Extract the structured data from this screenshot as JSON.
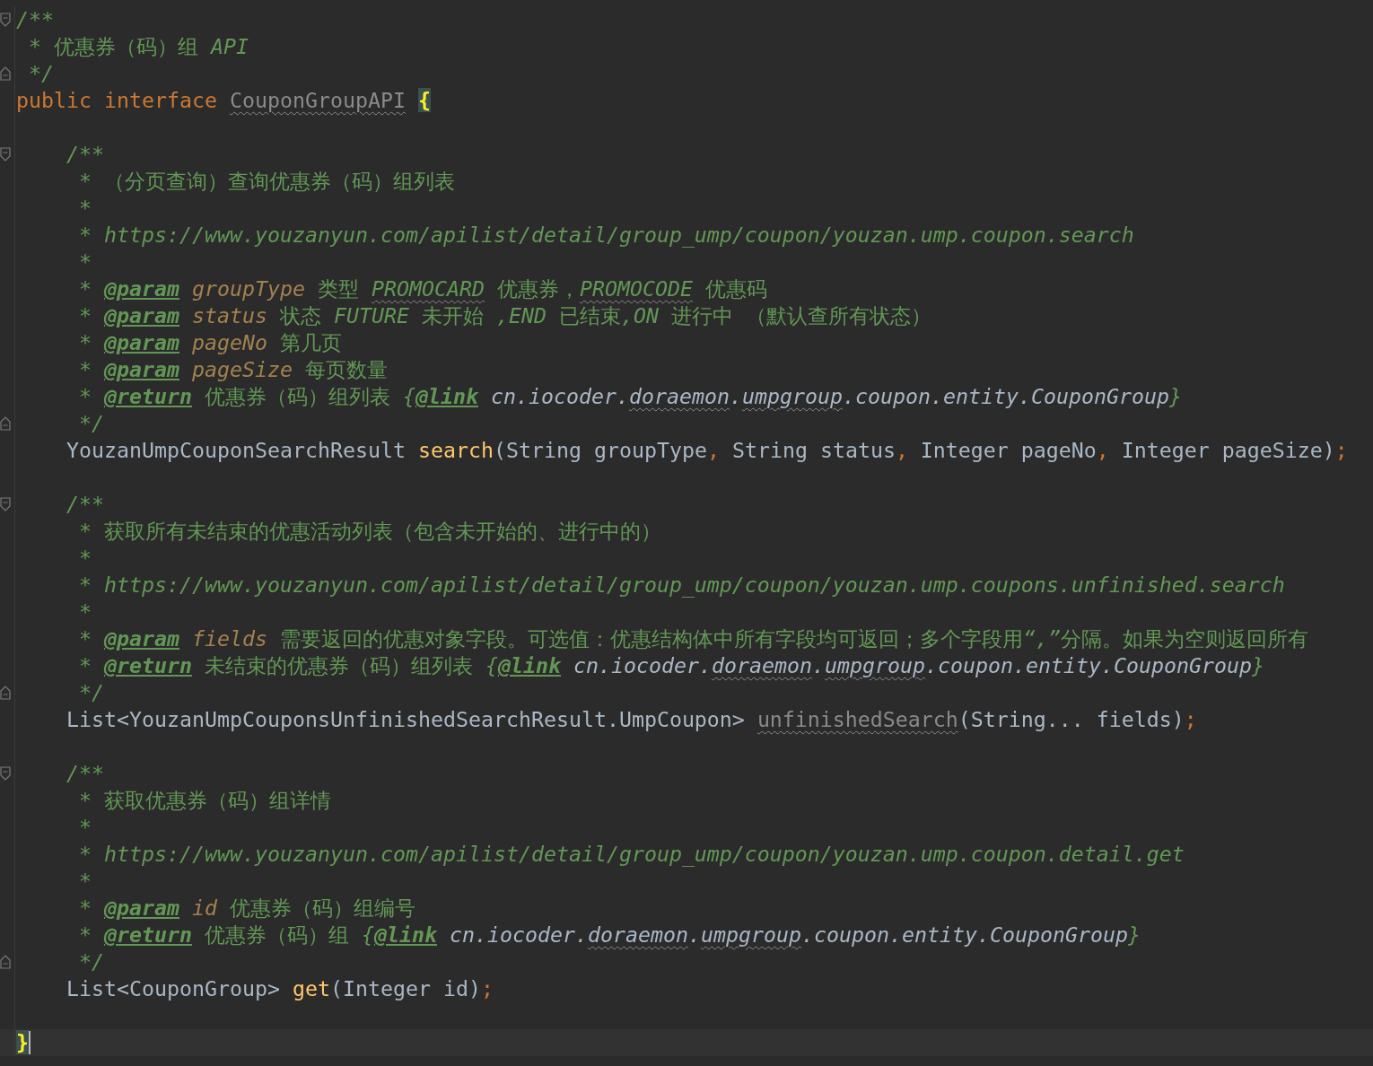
{
  "editor": {
    "lines": [
      {
        "kind": "fold-start",
        "current": false,
        "tokens": [
          {
            "text": "/**",
            "kind": "doc"
          }
        ]
      },
      {
        "kind": "code",
        "current": false,
        "tokens": [
          {
            "text": " * 优惠券（码）组 API",
            "kind": "doc"
          }
        ]
      },
      {
        "kind": "fold-end",
        "current": false,
        "tokens": [
          {
            "text": " */",
            "kind": "doc"
          }
        ]
      },
      {
        "kind": "code",
        "current": false,
        "tokens": [
          {
            "text": "public interface ",
            "kind": "keyword"
          },
          {
            "text": "CouponGroupAPI ",
            "kind": "unused"
          },
          {
            "text": "{",
            "kind": "brace"
          }
        ]
      },
      {
        "kind": "code",
        "current": false
      },
      {
        "kind": "fold-start",
        "current": false,
        "tokens": [
          {
            "text": "    /**",
            "kind": "doc"
          }
        ]
      },
      {
        "kind": "code",
        "current": false,
        "tokens": [
          {
            "text": "     * （分页查询）查询优惠券（码）组列表",
            "kind": "doc"
          }
        ]
      },
      {
        "kind": "code",
        "current": false,
        "tokens": [
          {
            "text": "     *",
            "kind": "doc"
          }
        ]
      },
      {
        "kind": "code",
        "current": false,
        "tokens": [
          {
            "text": "     * https://www.youzanyun.com/apilist/detail/group_ump/coupon/youzan.ump.coupon.search",
            "kind": "doc"
          }
        ]
      },
      {
        "kind": "code",
        "current": false,
        "tokens": [
          {
            "text": "     *",
            "kind": "doc"
          }
        ]
      },
      {
        "kind": "code",
        "current": false,
        "tokens": [
          {
            "text": "     * ",
            "kind": "doc"
          },
          {
            "text": "@param",
            "kind": "tag"
          },
          {
            "text": " groupType",
            "kind": "param"
          },
          {
            "text": " 类型 ",
            "kind": "doc"
          },
          {
            "text": "PROMOCARD",
            "kind": "docwave"
          },
          {
            "text": " 优惠券，",
            "kind": "doc"
          },
          {
            "text": "PROMOCODE",
            "kind": "docwave"
          },
          {
            "text": " 优惠码",
            "kind": "doc"
          }
        ]
      },
      {
        "kind": "code",
        "current": false,
        "tokens": [
          {
            "text": "     * ",
            "kind": "doc"
          },
          {
            "text": "@param",
            "kind": "tag"
          },
          {
            "text": " status",
            "kind": "param"
          },
          {
            "text": " 状态 FUTURE 未开始 ,END 已结束,ON 进行中 （默认查所有状态）",
            "kind": "doc"
          }
        ]
      },
      {
        "kind": "code",
        "current": false,
        "tokens": [
          {
            "text": "     * ",
            "kind": "doc"
          },
          {
            "text": "@param",
            "kind": "tag"
          },
          {
            "text": " pageNo",
            "kind": "param"
          },
          {
            "text": " 第几页",
            "kind": "doc"
          }
        ]
      },
      {
        "kind": "code",
        "current": false,
        "tokens": [
          {
            "text": "     * ",
            "kind": "doc"
          },
          {
            "text": "@param",
            "kind": "tag"
          },
          {
            "text": " pageSize",
            "kind": "param"
          },
          {
            "text": " 每页数量",
            "kind": "doc"
          }
        ]
      },
      {
        "kind": "code",
        "current": false,
        "tokens": [
          {
            "text": "     * ",
            "kind": "doc"
          },
          {
            "text": "@return",
            "kind": "tag"
          },
          {
            "text": " 优惠券（码）组列表 {",
            "kind": "doc"
          },
          {
            "text": "@link",
            "kind": "tag"
          },
          {
            "text": " cn.iocoder.",
            "kind": "ref"
          },
          {
            "text": "doraemon",
            "kind": "refwave"
          },
          {
            "text": ".",
            "kind": "ref"
          },
          {
            "text": "umpgroup",
            "kind": "refwave"
          },
          {
            "text": ".coupon.entity.CouponGroup",
            "kind": "ref"
          },
          {
            "text": "}",
            "kind": "doc"
          }
        ]
      },
      {
        "kind": "fold-end",
        "current": false,
        "tokens": [
          {
            "text": "     */",
            "kind": "doc"
          }
        ]
      },
      {
        "kind": "code",
        "current": false,
        "tokens": [
          {
            "text": "    YouzanUmpCouponSearchResult ",
            "kind": "plain"
          },
          {
            "text": "search",
            "kind": "method"
          },
          {
            "text": "(String groupType",
            "kind": "plain"
          },
          {
            "text": ",",
            "kind": "punct"
          },
          {
            "text": " String status",
            "kind": "plain"
          },
          {
            "text": ",",
            "kind": "punct"
          },
          {
            "text": " Integer pageNo",
            "kind": "plain"
          },
          {
            "text": ",",
            "kind": "punct"
          },
          {
            "text": " Integer pageSize)",
            "kind": "plain"
          },
          {
            "text": ";",
            "kind": "punct"
          }
        ]
      },
      {
        "kind": "code",
        "current": false
      },
      {
        "kind": "fold-start",
        "current": false,
        "tokens": [
          {
            "text": "    /**",
            "kind": "doc"
          }
        ]
      },
      {
        "kind": "code",
        "current": false,
        "tokens": [
          {
            "text": "     * 获取所有未结束的优惠活动列表（包含未开始的、进行中的）",
            "kind": "doc"
          }
        ]
      },
      {
        "kind": "code",
        "current": false,
        "tokens": [
          {
            "text": "     *",
            "kind": "doc"
          }
        ]
      },
      {
        "kind": "code",
        "current": false,
        "tokens": [
          {
            "text": "     * https://www.youzanyun.com/apilist/detail/group_ump/coupon/youzan.ump.coupons.unfinished.search",
            "kind": "doc"
          }
        ]
      },
      {
        "kind": "code",
        "current": false,
        "tokens": [
          {
            "text": "     *",
            "kind": "doc"
          }
        ]
      },
      {
        "kind": "code",
        "current": false,
        "tokens": [
          {
            "text": "     * ",
            "kind": "doc"
          },
          {
            "text": "@param",
            "kind": "tag"
          },
          {
            "text": " fields",
            "kind": "param"
          },
          {
            "text": " 需要返回的优惠对象字段。可选值：优惠结构体中所有字段均可返回；多个字段用“,”分隔。如果为空则返回所有",
            "kind": "doc"
          }
        ]
      },
      {
        "kind": "code",
        "current": false,
        "tokens": [
          {
            "text": "     * ",
            "kind": "doc"
          },
          {
            "text": "@return",
            "kind": "tag"
          },
          {
            "text": " 未结束的优惠券（码）组列表 {",
            "kind": "doc"
          },
          {
            "text": "@link",
            "kind": "tag"
          },
          {
            "text": " cn.iocoder.",
            "kind": "ref"
          },
          {
            "text": "doraemon",
            "kind": "refwave"
          },
          {
            "text": ".",
            "kind": "ref"
          },
          {
            "text": "umpgroup",
            "kind": "refwave"
          },
          {
            "text": ".coupon.entity.CouponGroup",
            "kind": "ref"
          },
          {
            "text": "}",
            "kind": "doc"
          }
        ]
      },
      {
        "kind": "fold-end",
        "current": false,
        "tokens": [
          {
            "text": "     */",
            "kind": "doc"
          }
        ]
      },
      {
        "kind": "code",
        "current": false,
        "tokens": [
          {
            "text": "    List<YouzanUmpCouponsUnfinishedSearchResult.UmpCoupon> ",
            "kind": "plain"
          },
          {
            "text": "unfinishedSearch",
            "kind": "unused"
          },
          {
            "text": "(String... fields)",
            "kind": "plain"
          },
          {
            "text": ";",
            "kind": "punct"
          }
        ]
      },
      {
        "kind": "code",
        "current": false
      },
      {
        "kind": "fold-start",
        "current": false,
        "tokens": [
          {
            "text": "    /**",
            "kind": "doc"
          }
        ]
      },
      {
        "kind": "code",
        "current": false,
        "tokens": [
          {
            "text": "     * 获取优惠券（码）组详情",
            "kind": "doc"
          }
        ]
      },
      {
        "kind": "code",
        "current": false,
        "tokens": [
          {
            "text": "     *",
            "kind": "doc"
          }
        ]
      },
      {
        "kind": "code",
        "current": false,
        "tokens": [
          {
            "text": "     * https://www.youzanyun.com/apilist/detail/group_ump/coupon/youzan.ump.coupon.detail.get",
            "kind": "doc"
          }
        ]
      },
      {
        "kind": "code",
        "current": false,
        "tokens": [
          {
            "text": "     *",
            "kind": "doc"
          }
        ]
      },
      {
        "kind": "code",
        "current": false,
        "tokens": [
          {
            "text": "     * ",
            "kind": "doc"
          },
          {
            "text": "@param",
            "kind": "tag"
          },
          {
            "text": " id",
            "kind": "param"
          },
          {
            "text": " 优惠券（码）组编号",
            "kind": "doc"
          }
        ]
      },
      {
        "kind": "code",
        "current": false,
        "tokens": [
          {
            "text": "     * ",
            "kind": "doc"
          },
          {
            "text": "@return",
            "kind": "tag"
          },
          {
            "text": " 优惠券（码）组 {",
            "kind": "doc"
          },
          {
            "text": "@link",
            "kind": "tag"
          },
          {
            "text": " cn.iocoder.",
            "kind": "ref"
          },
          {
            "text": "doraemon",
            "kind": "refwave"
          },
          {
            "text": ".",
            "kind": "ref"
          },
          {
            "text": "umpgroup",
            "kind": "refwave"
          },
          {
            "text": ".coupon.entity.CouponGroup",
            "kind": "ref"
          },
          {
            "text": "}",
            "kind": "doc"
          }
        ]
      },
      {
        "kind": "fold-end",
        "current": false,
        "tokens": [
          {
            "text": "     */",
            "kind": "doc"
          }
        ]
      },
      {
        "kind": "code",
        "current": false,
        "tokens": [
          {
            "text": "    List<CouponGroup> ",
            "kind": "plain"
          },
          {
            "text": "get",
            "kind": "method"
          },
          {
            "text": "(Integer id)",
            "kind": "plain"
          },
          {
            "text": ";",
            "kind": "punct"
          }
        ]
      },
      {
        "kind": "code",
        "current": false
      },
      {
        "kind": "code",
        "current": true,
        "tokens": [
          {
            "text": "}",
            "kind": "brace"
          }
        ]
      }
    ]
  }
}
